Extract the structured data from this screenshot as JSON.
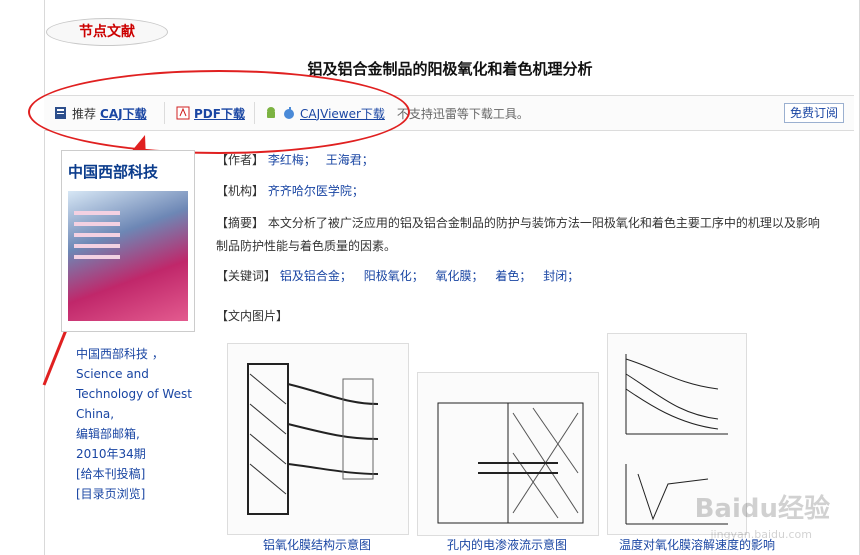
{
  "section_tab": "节点文献",
  "article_title": "铝及铝合金制品的阳极氧化和着色机理分析",
  "toolbar": {
    "recommend_label": "推荐",
    "caj_label": "CAJ下载",
    "pdf_label": "PDF下载",
    "cajviewer_label": "CAJViewer下载",
    "note": "不支持迅雷等下载工具。",
    "subscribe_label": "免费订阅"
  },
  "cover": {
    "title": "中国西部科技"
  },
  "journal": {
    "line1": "中国西部科技 ，",
    "line2": "Science and",
    "line3": "Technology of West",
    "line4": "China,",
    "line5": "编辑部邮箱,",
    "line6": "2010年34期",
    "line7": "[给本刊投稿]",
    "line8": "[目录页浏览]"
  },
  "meta": {
    "authors_label": "【作者】",
    "authors": [
      "李红梅；",
      "王海君；"
    ],
    "org_label": "【机构】",
    "org": "齐齐哈尔医学院；",
    "abstract_label": "【摘要】",
    "abstract_line1": "本文分析了被广泛应用的铝及铝合金制品的防护与装饰方法一阳极氧化和着色主要工序中的机理以及影响",
    "abstract_line2": "制品防护性能与着色质量的因素。",
    "keywords_label": "【关键词】",
    "keywords": [
      "铝及铝合金；",
      "阳极氧化；",
      "氧化膜；",
      "着色；",
      "封闭；"
    ],
    "images_label": "【文内图片】"
  },
  "figures": [
    {
      "caption": "铝氧化膜结构示意图"
    },
    {
      "caption": "孔内的电渗液流示意图"
    },
    {
      "caption": "温度对氧化膜溶解速度的影响"
    }
  ],
  "watermark": "Baidu经验",
  "watermark_sub": "jingyan.baidu.com",
  "colors": {
    "link": "#1a46a3",
    "accent": "#cc0000",
    "annotation": "#e02020"
  }
}
